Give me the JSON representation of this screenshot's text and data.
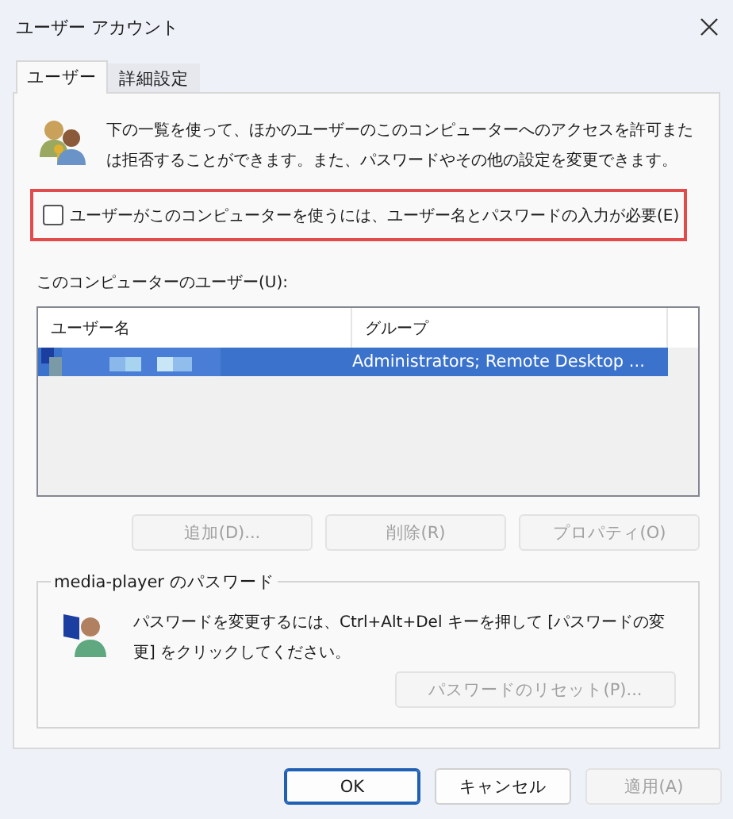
{
  "window": {
    "title": "ユーザー アカウント"
  },
  "tabs": [
    {
      "label": "ユーザー",
      "selected": true
    },
    {
      "label": "詳細設定",
      "selected": false
    }
  ],
  "intro": "下の一覧を使って、ほかのユーザーのこのコンピューターへのアクセスを許可または拒否することができます。また、パスワードやその他の設定を変更できます。",
  "require_login": {
    "label": "ユーザーがこのコンピューターを使うには、ユーザー名とパスワードの入力が必要(E)",
    "checked": false,
    "highlighted": true
  },
  "users_label": "このコンピューターのユーザー(U):",
  "table": {
    "columns": [
      "ユーザー名",
      "グループ"
    ],
    "rows": [
      {
        "group": "Administrators; Remote Desktop ...",
        "selected": true
      }
    ]
  },
  "user_buttons": [
    {
      "label": "追加(D)...",
      "disabled": true
    },
    {
      "label": "削除(R)",
      "disabled": true
    },
    {
      "label": "プロパティ(O)",
      "disabled": true
    }
  ],
  "password_group": {
    "title": "media-player のパスワード",
    "text": "パスワードを変更するには、Ctrl+Alt+Del キーを押して [パスワードの変更] をクリックしてください。",
    "button": {
      "label": "パスワードのリセット(P)...",
      "disabled": true
    }
  },
  "footer_buttons": [
    {
      "label": "OK",
      "disabled": false,
      "default": true
    },
    {
      "label": "キャンセル",
      "disabled": false,
      "default": false
    },
    {
      "label": "適用(A)",
      "disabled": true,
      "default": false
    }
  ]
}
